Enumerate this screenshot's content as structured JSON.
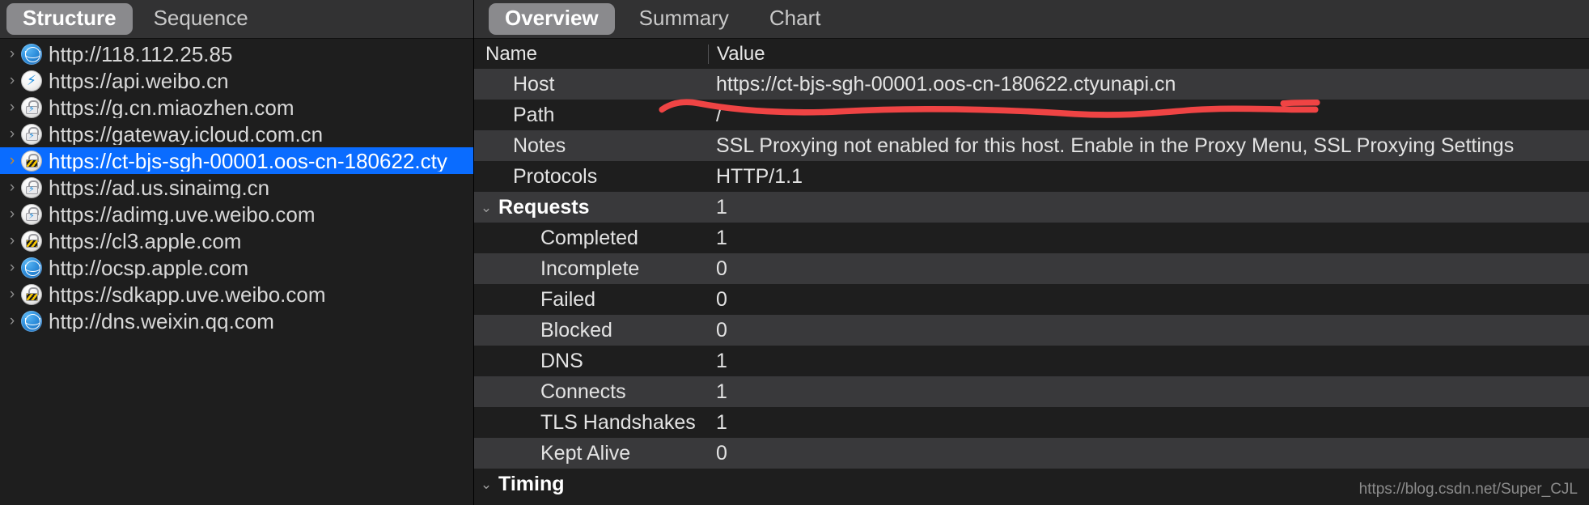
{
  "left_panel": {
    "tabs": [
      {
        "label": "Structure",
        "active": true
      },
      {
        "label": "Sequence",
        "active": false
      }
    ],
    "tree_items": [
      {
        "label": "http://118.112.25.85",
        "icon": "globe-icon",
        "selected": false
      },
      {
        "label": "https://api.weibo.cn",
        "icon": "bolt-icon",
        "selected": false
      },
      {
        "label": "https://g.cn.miaozhen.com",
        "icon": "lock-bolt-icon",
        "selected": false
      },
      {
        "label": "https://gateway.icloud.com.cn",
        "icon": "lock-bolt-icon",
        "selected": false
      },
      {
        "label": "https://ct-bjs-sgh-00001.oos-cn-180622.cty",
        "icon": "lock-stripes-icon",
        "selected": true
      },
      {
        "label": "https://ad.us.sinaimg.cn",
        "icon": "lock-bolt-icon",
        "selected": false
      },
      {
        "label": "https://adimg.uve.weibo.com",
        "icon": "lock-bolt-icon",
        "selected": false
      },
      {
        "label": "https://cl3.apple.com",
        "icon": "lock-stripes-icon",
        "selected": false
      },
      {
        "label": "http://ocsp.apple.com",
        "icon": "globe-icon",
        "selected": false
      },
      {
        "label": "https://sdkapp.uve.weibo.com",
        "icon": "lock-stripes-icon",
        "selected": false
      },
      {
        "label": "http://dns.weixin.qq.com",
        "icon": "globe-icon",
        "selected": false
      }
    ]
  },
  "right_panel": {
    "tabs": [
      {
        "label": "Overview",
        "active": true
      },
      {
        "label": "Summary",
        "active": false
      },
      {
        "label": "Chart",
        "active": false
      }
    ],
    "columns": {
      "name": "Name",
      "value": "Value"
    },
    "rows": [
      {
        "name": "Host",
        "value": "https://ct-bjs-sgh-00001.oos-cn-180622.ctyunapi.cn",
        "indent": 1,
        "group": false,
        "chevron": ""
      },
      {
        "name": "Path",
        "value": "/",
        "indent": 1,
        "group": false,
        "chevron": ""
      },
      {
        "name": "Notes",
        "value": "SSL Proxying not enabled for this host. Enable in the Proxy Menu, SSL Proxying Settings",
        "indent": 1,
        "group": false,
        "chevron": ""
      },
      {
        "name": "Protocols",
        "value": "HTTP/1.1",
        "indent": 1,
        "group": false,
        "chevron": ""
      },
      {
        "name": "Requests",
        "value": "1",
        "indent": 0,
        "group": true,
        "chevron": "⌄"
      },
      {
        "name": "Completed",
        "value": "1",
        "indent": 2,
        "group": false,
        "chevron": ""
      },
      {
        "name": "Incomplete",
        "value": "0",
        "indent": 2,
        "group": false,
        "chevron": ""
      },
      {
        "name": "Failed",
        "value": "0",
        "indent": 2,
        "group": false,
        "chevron": ""
      },
      {
        "name": "Blocked",
        "value": "0",
        "indent": 2,
        "group": false,
        "chevron": ""
      },
      {
        "name": "DNS",
        "value": "1",
        "indent": 2,
        "group": false,
        "chevron": ""
      },
      {
        "name": "Connects",
        "value": "1",
        "indent": 2,
        "group": false,
        "chevron": ""
      },
      {
        "name": "TLS Handshakes",
        "value": "1",
        "indent": 2,
        "group": false,
        "chevron": ""
      },
      {
        "name": "Kept Alive",
        "value": "0",
        "indent": 2,
        "group": false,
        "chevron": ""
      },
      {
        "name": "Timing",
        "value": "",
        "indent": 0,
        "group": true,
        "chevron": "⌄"
      }
    ]
  },
  "annotation": {
    "color": "#ef4444",
    "target_row": "Notes"
  },
  "watermark": {
    "text": "https://blog.csdn.net/Super_CJL"
  },
  "colors": {
    "selection_blue": "#0a6cff",
    "tab_active_bg": "#8a8a8d",
    "row_odd_bg": "#39393b",
    "row_even_bg": "#1e1e1e",
    "panel_bg": "#1e1e1e",
    "tabbar_bg": "#323233",
    "annotation_red": "#ef4444"
  }
}
